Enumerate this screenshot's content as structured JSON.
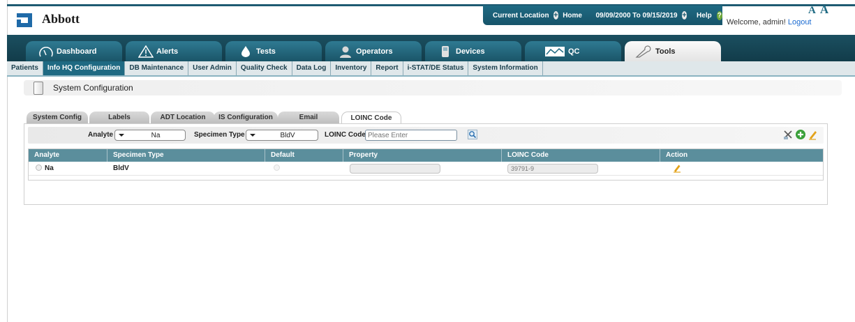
{
  "brand": {
    "name": "Abbott"
  },
  "status": {
    "current_location_label": "Current Location",
    "location": "Home",
    "date_range": "09/09/2000 To 09/15/2019",
    "help_label": "Help",
    "help_icon": "?",
    "plus_icon": "+"
  },
  "user": {
    "welcome": "Welcome, admin!",
    "logout": "Logout"
  },
  "font_size": {
    "small": "A",
    "large": "A"
  },
  "main_nav": {
    "tabs": [
      {
        "label": "Dashboard",
        "icon": "gauge-icon"
      },
      {
        "label": "Alerts",
        "icon": "warning-icon"
      },
      {
        "label": "Tests",
        "icon": "drop-icon"
      },
      {
        "label": "Operators",
        "icon": "operator-icon"
      },
      {
        "label": "Devices",
        "icon": "device-icon"
      },
      {
        "label": "QC",
        "icon": "qc-chart-icon"
      },
      {
        "label": "Tools",
        "icon": "wrench-icon",
        "active": true
      }
    ]
  },
  "sub_nav": {
    "items": [
      "Patients",
      "Info HQ Configuration",
      "DB Maintenance",
      "User Admin",
      "Quality Check",
      "Data Log",
      "Inventory",
      "Report",
      "i-STAT/DE Status",
      "System Information"
    ],
    "active": "Info HQ Configuration"
  },
  "page": {
    "title": "System Configuration"
  },
  "config_tabs": {
    "items": [
      "System Config",
      "Labels",
      "ADT Location",
      "IS Configuration",
      "Email",
      "LOINC Code"
    ],
    "active": "LOINC Code"
  },
  "filter": {
    "analyte_label": "Analyte",
    "analyte_value": "Na",
    "specimen_label": "Specimen Type",
    "specimen_value": "BldV",
    "loinc_label": "LOINC Code",
    "loinc_placeholder": "Please Enter"
  },
  "table": {
    "headers": [
      "Analyte",
      "Specimen Type",
      "Default",
      "Property",
      "LOINC Code",
      "Action"
    ],
    "rows": [
      {
        "analyte": "Na",
        "specimen_type": "BldV",
        "default": false,
        "property": "",
        "loinc_code": "39791-9"
      }
    ]
  },
  "colors": {
    "header": "#1f6a83",
    "nav": "#123c4a",
    "grid_header": "#5b8e9c",
    "accent_green": "#3aa03a",
    "pencil": "#e3a21a"
  }
}
